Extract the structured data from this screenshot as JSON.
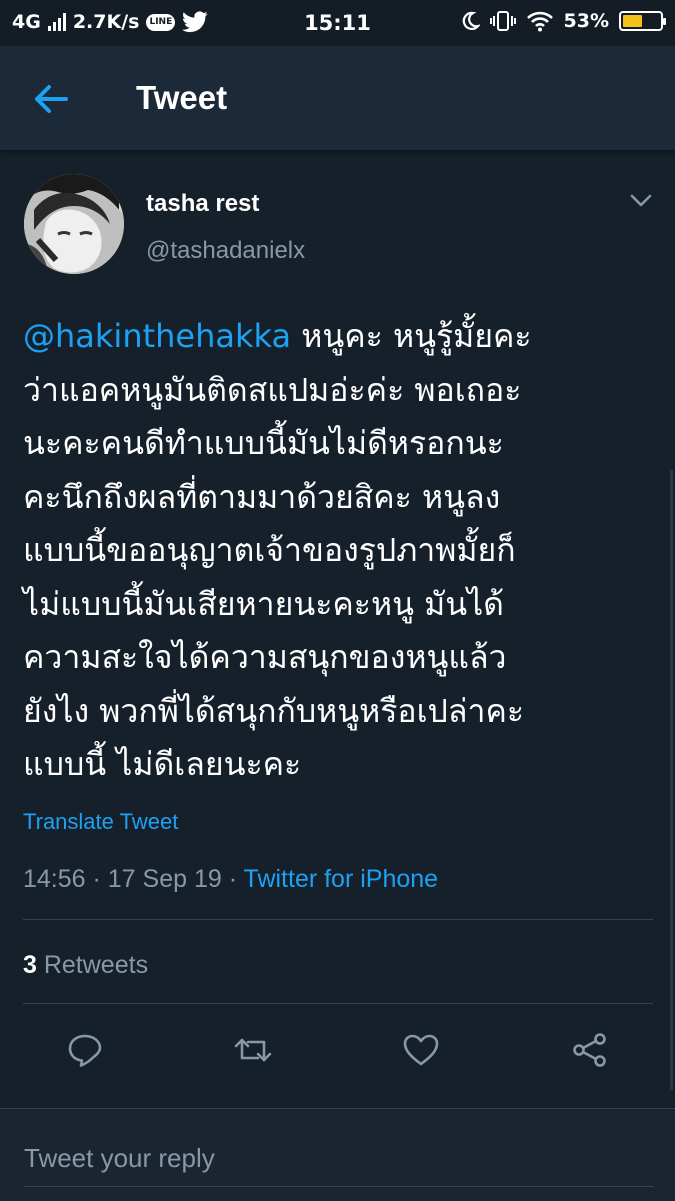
{
  "status_bar": {
    "network": "4G",
    "speed": "2.7K/s",
    "line_badge": "LINE",
    "time": "15:11",
    "battery": "53%",
    "battery_level": 0.53,
    "battery_color": "#f2c21a"
  },
  "header": {
    "title": "Tweet",
    "back_icon": "arrow-left-icon",
    "accent": "#1da1f2"
  },
  "tweet": {
    "author": {
      "display_name": "tasha rest",
      "handle": "@tashadanielx"
    },
    "text": {
      "mention": "@hakinthehakka",
      "line1_rest": " หนูคะ หนูรู้มั้ยคะ",
      "lines": [
        "ว่าแอคหนูมันติดสแปมอ่ะค่ะ พอเถอะ",
        "นะคะคนดีทำแบบนี้มันไม่ดีหรอกนะ",
        "คะนึกถึงผลที่ตามมาด้วยสิคะ หนูลง",
        "แบบนี้ขออนุญาตเจ้าของรูปภาพมั้ยก็",
        "ไม่แบบนี้มันเสียหายนะคะหนู มันได้",
        "ความสะใจได้ความสนุกของหนูแล้ว",
        "ยังไง พวกพี่ได้สนุกกับหนูหรือเปล่าคะ",
        "แบบนี้ ไม่ดีเลยนะคะ"
      ]
    },
    "translate_label": "Translate Tweet",
    "time": "14:56",
    "separator": " · ",
    "date": "17 Sep 19",
    "source": "Twitter for iPhone",
    "retweet_count": "3",
    "retweet_label": " Retweets"
  },
  "actions": {
    "reply_icon": "reply-icon",
    "retweet_icon": "retweet-icon",
    "like_icon": "heart-icon",
    "share_icon": "share-icon"
  },
  "reply": {
    "placeholder": "Tweet your reply"
  },
  "colors": {
    "background": "#15202b",
    "header": "#1c2938",
    "secondary_text": "#8899a6",
    "divider": "#38444d"
  }
}
